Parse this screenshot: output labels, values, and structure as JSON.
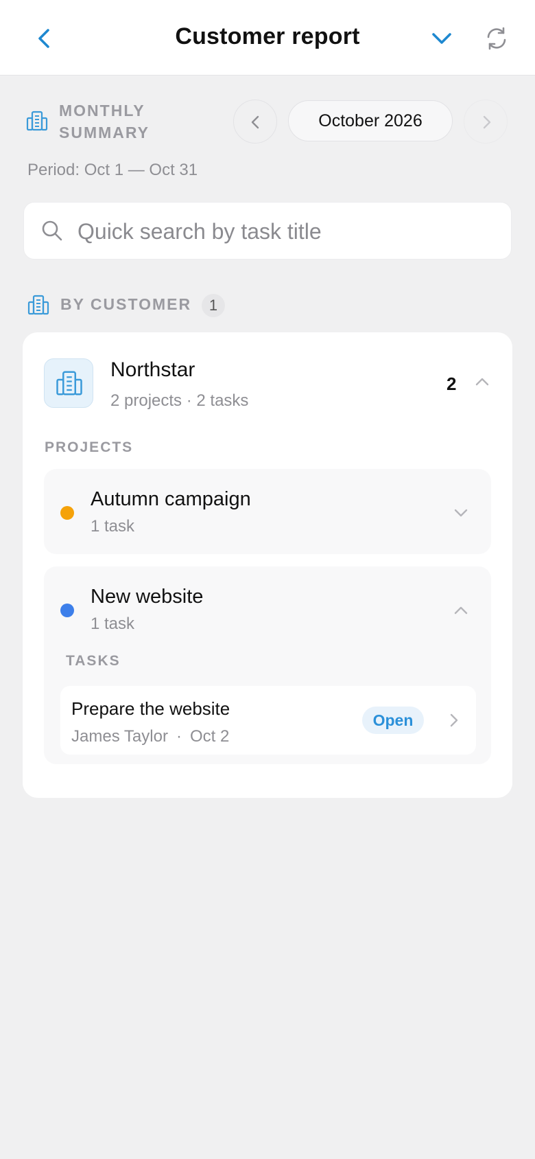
{
  "header": {
    "title": "Customer report",
    "back_icon": "chevron-left-icon",
    "dropdown_icon": "chevron-down-icon",
    "refresh_icon": "refresh-icon",
    "accent_color": "#1e88d0"
  },
  "summary": {
    "icon": "building-icon",
    "label": "MONTHLY SUMMARY",
    "month": "October 2026",
    "period": "Period: Oct 1 — Oct 31"
  },
  "search": {
    "placeholder": "Quick search by task title",
    "value": ""
  },
  "by_customer": {
    "label": "BY CUSTOMER",
    "count": "1"
  },
  "customer": {
    "name": "Northstar",
    "meta": "2 projects · 2 tasks",
    "count": "2",
    "expanded": true,
    "projects_label": "PROJECTS",
    "projects": [
      {
        "name": "Autumn campaign",
        "count": "1 task",
        "color": "#f5a20a",
        "expanded": false
      },
      {
        "name": "New website",
        "count": "1 task",
        "color": "#3d7fea",
        "expanded": true,
        "tasks_label": "TASKS",
        "tasks": [
          {
            "title": "Prepare the website",
            "assignee": "James Taylor",
            "separator": "·",
            "date": "Oct 2",
            "status": "Open"
          }
        ]
      }
    ]
  }
}
